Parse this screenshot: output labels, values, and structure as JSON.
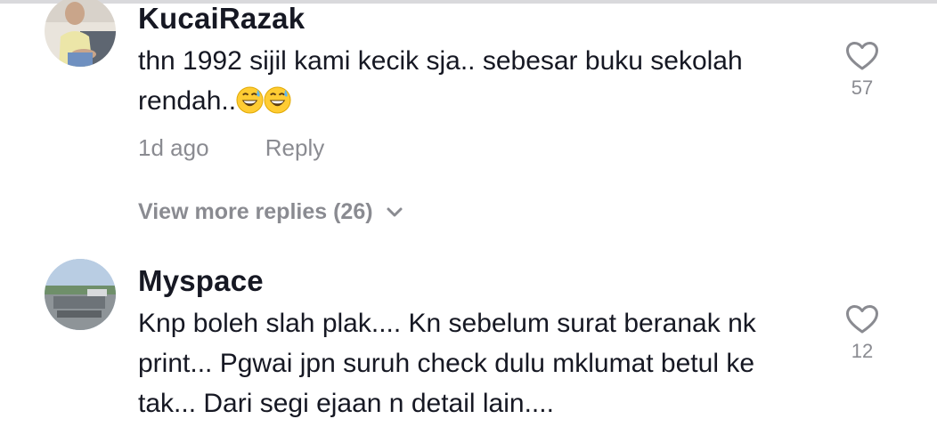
{
  "comments": [
    {
      "username": "KucaiRazak",
      "text_line1": "thn 1992 sijil kami kecik sja.. sebesar buku sekolah",
      "text_line2": "rendah..",
      "emoji": [
        "grinning-sweat-emoji",
        "grinning-sweat-emoji"
      ],
      "time": "1d ago",
      "reply_label": "Reply",
      "like_count": "57",
      "more_replies_label": "View more replies (26)"
    },
    {
      "username": "Myspace",
      "text_line1": "Knp boleh slah plak.... Kn sebelum surat beranak nk",
      "text_line2": "print... Pgwai jpn suruh check dulu mklumat betul ke",
      "text_line3": "tak... Dari segi ejaan n detail lain....",
      "like_count": "12"
    }
  ],
  "icons": {
    "like": "heart-outline-icon",
    "expand": "chevron-down-icon"
  },
  "colors": {
    "text": "#161823",
    "muted": "#8a8b91",
    "divider": "#d9d9dc"
  }
}
